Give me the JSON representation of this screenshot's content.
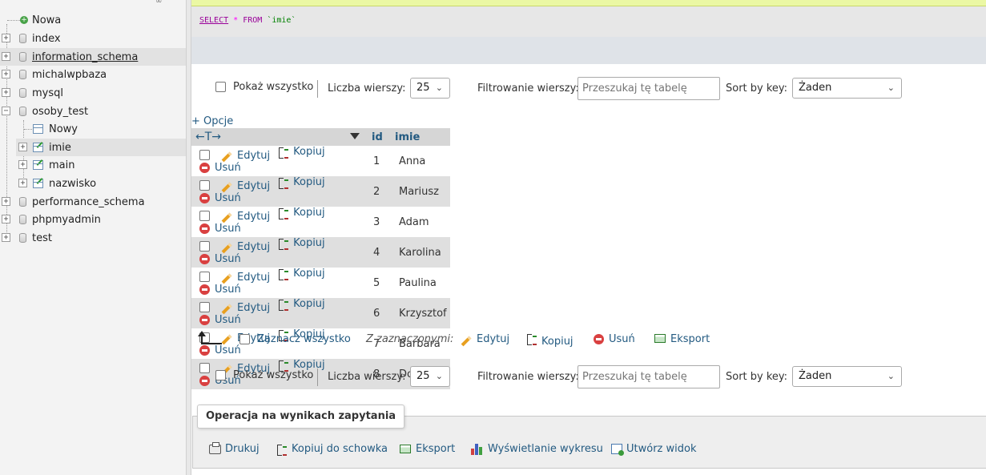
{
  "nav": {
    "tree": [
      {
        "label": "Nowa",
        "type": "new"
      },
      {
        "label": "index",
        "type": "db"
      },
      {
        "label": "information_schema",
        "type": "db",
        "highlighted": true
      },
      {
        "label": "michalwpbaza",
        "type": "db"
      },
      {
        "label": "mysql",
        "type": "db"
      },
      {
        "label": "osoby_test",
        "type": "db",
        "expanded": true
      },
      {
        "label": "Nowy",
        "type": "new-table"
      },
      {
        "label": "imie",
        "type": "table",
        "selected": true
      },
      {
        "label": "main",
        "type": "table"
      },
      {
        "label": "nazwisko",
        "type": "table"
      },
      {
        "label": "performance_schema",
        "type": "db"
      },
      {
        "label": "phpmyadmin",
        "type": "db"
      },
      {
        "label": "test",
        "type": "db"
      }
    ]
  },
  "query": {
    "select_kw": "SELECT",
    "star": "*",
    "from_kw": "FROM",
    "table": "`imie`"
  },
  "navbar": {
    "show_all": "Pokaż wszystko",
    "rows_label": "Liczba wierszy:",
    "rows_value": "25",
    "filter_label": "Filtrowanie wierszy:",
    "filter_placeholder": "Przeszukaj tę tabelę",
    "sort_label": "Sort by key:",
    "sort_value": "Żaden"
  },
  "options_link": "+ Opcje",
  "table": {
    "columns": [
      "id",
      "imie"
    ],
    "action_labels": {
      "edit": "Edytuj",
      "copy": "Kopiuj",
      "delete": "Usuń"
    },
    "rows": [
      {
        "id": "1",
        "imie": "Anna"
      },
      {
        "id": "2",
        "imie": "Mariusz"
      },
      {
        "id": "3",
        "imie": "Adam"
      },
      {
        "id": "4",
        "imie": "Karolina"
      },
      {
        "id": "5",
        "imie": "Paulina"
      },
      {
        "id": "6",
        "imie": "Krzysztof"
      },
      {
        "id": "7",
        "imie": "Barbara"
      },
      {
        "id": "8",
        "imie": "Dominik"
      }
    ]
  },
  "bulk": {
    "select_all": "Zaznacz wszystko",
    "with_selected": "Z zaznaczonymi:",
    "edit": "Edytuj",
    "copy": "Kopiuj",
    "delete": "Usuń",
    "export": "Eksport"
  },
  "ops": {
    "legend": "Operacja na wynikach zapytania",
    "print": "Drukuj",
    "copy_clipboard": "Kopiuj do schowka",
    "export": "Eksport",
    "chart": "Wyświetlanie wykresu",
    "create_view": "Utwórz widok"
  },
  "colors": {
    "link": "#235a81",
    "row_alt": "#dfdfdf",
    "header_bg": "#d6d6d6",
    "delete_red": "#d94040"
  }
}
